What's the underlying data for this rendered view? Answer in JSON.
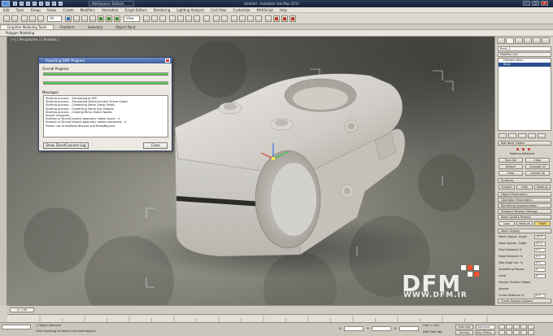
{
  "window": {
    "project_name": "Workspace: Default",
    "title": "Untitled - Autodesk 3ds Max 2011",
    "controls": [
      "-",
      "□",
      "×"
    ]
  },
  "menu": [
    "Edit",
    "Tools",
    "Group",
    "Views",
    "Create",
    "Modifiers",
    "Animation",
    "Graph Editors",
    "Rendering",
    "Lighting Analysis",
    "Civil View",
    "Customize",
    "MAXScript",
    "Help"
  ],
  "toolbar": {
    "selection_filter": "All",
    "reference_coord": "View"
  },
  "ribbon": {
    "tabs": [
      "Graphite Modeling Tools",
      "Freeform",
      "Selection",
      "Object Paint"
    ],
    "active_tab": 0,
    "sub_label": "Polygon Modeling"
  },
  "viewport": {
    "label": "[+] [ Perspective ] [ Realistic ]"
  },
  "dialog": {
    "title": "Importing DWF Progress",
    "heading": "Overall Progress",
    "progress": [
      1.0,
      1.0
    ],
    "messages_label": "Messages",
    "messages": [
      "Starting process - Translating to XPF",
      "Starting process - Translating DirectConnect Scene Graph",
      "Starting process - Combining Same Group Shells",
      "Starting process - Combining Same Sub Objects",
      "Starting process - Creating Bimu Object Nodes",
      "Import complete.",
      "Number of DirectConnect geometry nodes found : 4",
      "Number of DirectConnect geometry nodes processed : 4",
      "Please use Undo/Redo Beyond and Redo/Beyond"
    ],
    "show_log_button": "Show DirectConnect Log",
    "close_button": "Close"
  },
  "command_panel": {
    "object_name": "Body_1",
    "modifier_list": "Modifier List",
    "stack": [
      "Editable Mesh",
      "Body"
    ],
    "stack_selected": 1,
    "sections": {
      "edit_body": "Edit Body Object",
      "surfaces": "Surfaces",
      "object_parameters": "Object Parameters",
      "operation_parameters": "Operation Parameters",
      "rendering_approx": "Rendering Approximation",
      "viewport_display": "Viewport Display Settings",
      "mesh_quality": "Mesh Quality Presets",
      "mesh_display": "Mesh Display",
      "curve_display": "Curve Display",
      "chord_display": "Chord Display Options"
    },
    "buttons": {
      "nothing_selected": "Nothing Selected",
      "face_sel": "Face Sel",
      "clear": "Clear",
      "detach": "Detach",
      "explode_all": "Explode All",
      "hide": "Hide",
      "unhide_all": "Unhide All",
      "smooth": "Smooth",
      "high": "High",
      "medium": "Medium",
      "low": "Low"
    },
    "settings": [
      {
        "label": "Mesh Approx. Angle",
        "value": "15.0"
      },
      {
        "label": "Edge Approx. Angle",
        "value": "20.0"
      },
      {
        "label": "Face Distance %",
        "value": "0.5"
      },
      {
        "label": "Edge Distance %",
        "value": "0.5"
      },
      {
        "label": "Max Edge Len. %",
        "value": "0.0"
      },
      {
        "label": "Smoothing Passes",
        "value": "0"
      },
      {
        "label": "Level",
        "value": "6"
      },
      {
        "label": "Display Surface Edges",
        "value": ""
      },
      {
        "label": "Approx.",
        "value": ""
      },
      {
        "label": "Curve Distance %",
        "value": "0.5"
      }
    ]
  },
  "timeline": {
    "slider": "0 / 100"
  },
  "status": {
    "selection": "1 Object Selected",
    "prompt": "Click and drag to select and move objects",
    "x_label": "X:",
    "y_label": "Y:",
    "z_label": "Z:",
    "grid": "Grid = 10.0",
    "auto_key": "Auto Key",
    "set_key": "Set Key",
    "selected": "Selected",
    "key_filters": "Key Filters...",
    "add_time_tag": "Add Time Tag"
  },
  "watermark": {
    "brand": "DFM",
    "url": "WWW.DFM.IR",
    "colors": [
      "#ffffff",
      "#f0502e"
    ]
  },
  "colors": {
    "titlebar": "#1f2c44",
    "progress_green": "#2fb32a",
    "selection_blue": "#2a4f8f",
    "bbox_white": "#e8e8e8"
  }
}
